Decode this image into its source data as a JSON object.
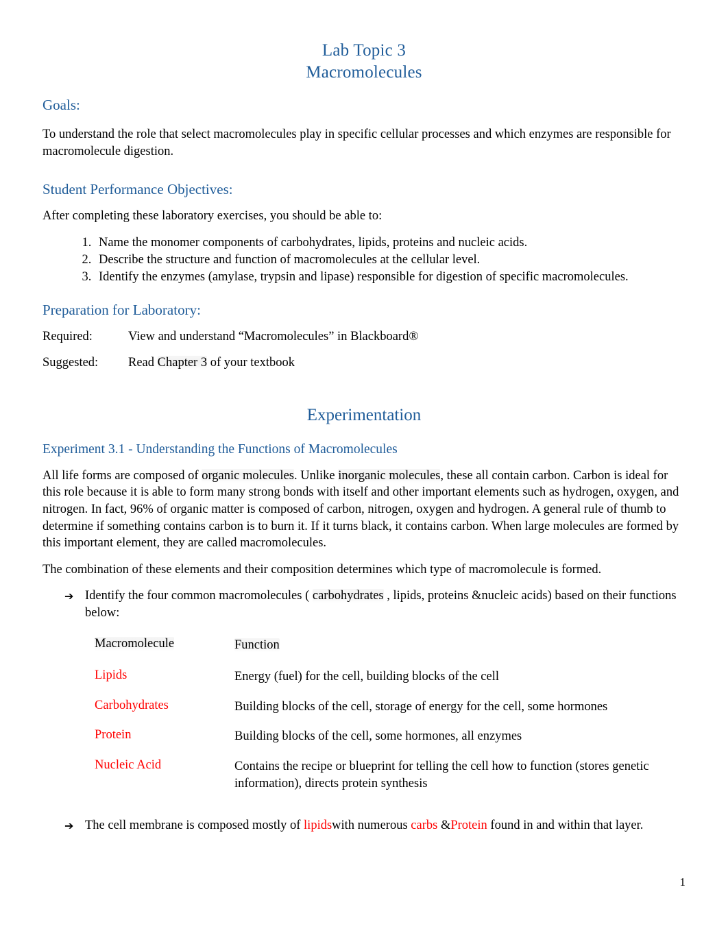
{
  "title": {
    "line1": "Lab Topic 3",
    "line2": "Macromolecules"
  },
  "goals": {
    "heading": "Goals:",
    "body": "To understand the role that select macromolecules play in specific cellular processes and which enzymes are responsible for macromolecule digestion."
  },
  "objectives": {
    "heading": "Student Performance Objectives:",
    "intro": "After completing these laboratory exercises, you should be able to:",
    "items": [
      "Name the monomer components of carbohydrates, lipids, proteins and nucleic acids.",
      "Describe the structure and function of macromolecules at the cellular level.",
      "Identify the enzymes (amylase, trypsin and lipase) responsible for digestion of specific macromolecules."
    ]
  },
  "preparation": {
    "heading": "Preparation for Laboratory:",
    "required_label": "Required:",
    "required_value": "View and understand “Macromolecules” in Blackboard®",
    "suggested_label": "Suggested:",
    "suggested_value_pre": "Read ",
    "suggested_value_highlight": "Chapter 3",
    "suggested_value_post": " of your textbook"
  },
  "experimentation": {
    "heading": "Experimentation",
    "experiment_heading": "Experiment 3.1 - Understanding the Functions of Macromolecules",
    "paragraph1_part1": "All life forms are composed of ",
    "paragraph1_hl1": "organic molecules",
    "paragraph1_part2": ". Unlike ",
    "paragraph1_hl2": "inorganic molecules",
    "paragraph1_part3": ", these all contain carbon.  Carbon is ideal for this role because it is able to form many strong bonds with itself and other important elements such as hydrogen, oxygen, and nitrogen. In fact, 96% of organic matter is composed of carbon, nitrogen, oxygen and hydrogen. A general rule of thumb to determine if something contains carbon is to burn it. If it turns black, it contains carbon. When large molecules are formed by this important element, they are called macromolecules.",
    "paragraph2": "The combination of these elements and their composition determines which type of macromolecule is formed."
  },
  "bullet1": {
    "arrow": "➔",
    "text_part1": "Identify the four common macromolecules ( ",
    "text_hl": "carbohydrates",
    "text_part2": " , lipids, proteins  &",
    "text_part3": "nucleic acids) based on their functions below:"
  },
  "table": {
    "header_macromolecule": "Macromolecule",
    "header_function": "Function",
    "rows": [
      {
        "macromolecule": "Lipids",
        "function": "Energy (fuel) for the cell, building blocks of the cell"
      },
      {
        "macromolecule": "Carbohydrates",
        "function": "Building blocks of the cell, storage of energy for the cell, some hormones"
      },
      {
        "macromolecule": "Protein",
        "function": "Building blocks of the cell, some hormones, all enzymes"
      },
      {
        "macromolecule": "Nucleic Acid",
        "function": "Contains the recipe or blueprint for telling the cell how to function (stores genetic information), directs protein synthesis"
      }
    ]
  },
  "bullet2": {
    "arrow": "➔",
    "part1": "The cell membrane is composed mostly of ",
    "red1": " lipids",
    "part2": "with numerous ",
    "red2": " carbs",
    "part3": " &",
    "red3": "Protein",
    "part4": " found in and within that layer."
  },
  "footer": {
    "page_number": "1"
  },
  "colors": {
    "heading_blue": "#1F5C99",
    "answer_red": "#FF0000",
    "text_black": "#000000"
  }
}
